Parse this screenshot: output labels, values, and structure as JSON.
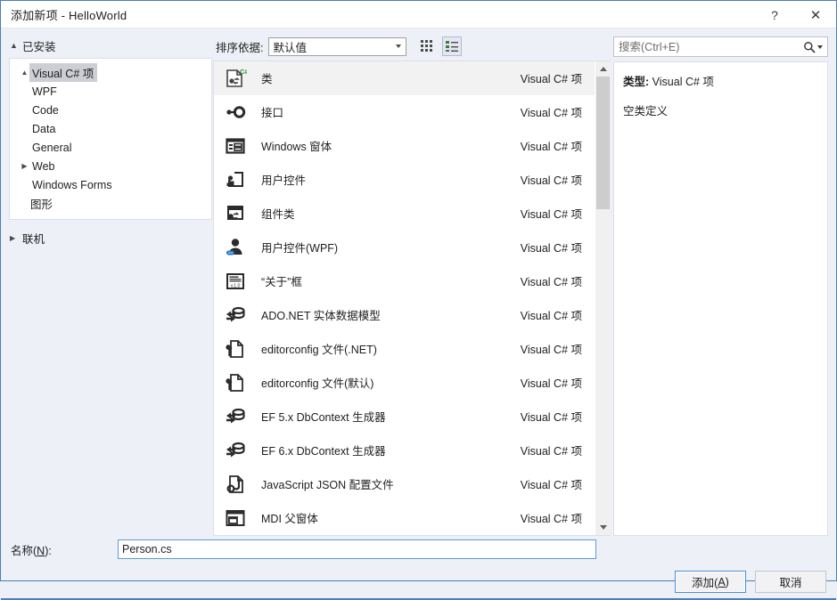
{
  "window": {
    "title": "添加新项 - HelloWorld",
    "help_label": "?",
    "close_label": "✕",
    "accent_color": "#4a7ebb"
  },
  "sidebar": {
    "installed_header": "已安装",
    "online_header": "联机",
    "tree": [
      {
        "label": "Visual C# 项",
        "depth": 0,
        "twisty": "▲",
        "selected": true
      },
      {
        "label": "WPF",
        "depth": 1,
        "twisty": "",
        "selected": false
      },
      {
        "label": "Code",
        "depth": 1,
        "twisty": "",
        "selected": false
      },
      {
        "label": "Data",
        "depth": 1,
        "twisty": "",
        "selected": false
      },
      {
        "label": "General",
        "depth": 1,
        "twisty": "",
        "selected": false
      },
      {
        "label": "Web",
        "depth": 1,
        "twisty": "▶",
        "selected": false
      },
      {
        "label": "Windows Forms",
        "depth": 1,
        "twisty": "",
        "selected": false
      },
      {
        "label": "图形",
        "depth": 0,
        "twisty": "",
        "selected": false
      }
    ]
  },
  "toolbar": {
    "sort_label": "排序依据:",
    "sort_value": "默认值",
    "view_tiles_name": "medium-icons-view",
    "view_details_name": "details-view",
    "active_view": "details"
  },
  "list": {
    "items": [
      {
        "name": "类",
        "kind": "Visual C# 项",
        "icon": "csharp-class-icon",
        "selected": true
      },
      {
        "name": "接口",
        "kind": "Visual C# 项",
        "icon": "interface-icon",
        "selected": false
      },
      {
        "name": "Windows 窗体",
        "kind": "Visual C# 项",
        "icon": "windows-form-icon",
        "selected": false
      },
      {
        "name": "用户控件",
        "kind": "Visual C# 项",
        "icon": "user-control-icon",
        "selected": false
      },
      {
        "name": "组件类",
        "kind": "Visual C# 项",
        "icon": "component-class-icon",
        "selected": false
      },
      {
        "name": "用户控件(WPF)",
        "kind": "Visual C# 项",
        "icon": "wpf-user-control-icon",
        "selected": false
      },
      {
        "name": "“关于”框",
        "kind": "Visual C# 项",
        "icon": "about-box-icon",
        "selected": false
      },
      {
        "name": "ADO.NET 实体数据模型",
        "kind": "Visual C# 项",
        "icon": "ado-entity-model-icon",
        "selected": false
      },
      {
        "name": "editorconfig 文件(.NET)",
        "kind": "Visual C# 项",
        "icon": "editorconfig-file-icon",
        "selected": false
      },
      {
        "name": "editorconfig 文件(默认)",
        "kind": "Visual C# 项",
        "icon": "editorconfig-file-icon",
        "selected": false
      },
      {
        "name": "EF 5.x DbContext 生成器",
        "kind": "Visual C# 项",
        "icon": "ado-entity-model-icon",
        "selected": false
      },
      {
        "name": "EF 6.x DbContext 生成器",
        "kind": "Visual C# 项",
        "icon": "ado-entity-model-icon",
        "selected": false
      },
      {
        "name": "JavaScript JSON 配置文件",
        "kind": "Visual C# 项",
        "icon": "json-file-icon",
        "selected": false
      },
      {
        "name": "MDI 父窗体",
        "kind": "Visual C# 项",
        "icon": "mdi-parent-form-icon",
        "selected": false
      }
    ],
    "scroll_thumb_top_pct": 0,
    "scroll_thumb_height_pct": 30
  },
  "search": {
    "placeholder": "搜索(Ctrl+E)",
    "value": ""
  },
  "details": {
    "type_label": "类型:",
    "type_value": "Visual C# 项",
    "description": "空类定义"
  },
  "footer": {
    "name_label_prefix": "名称(",
    "name_label_accel": "N",
    "name_label_suffix": "):",
    "name_value": "Person.cs",
    "add_prefix": "添加(",
    "add_accel": "A",
    "add_suffix": ")",
    "cancel_label": "取消"
  }
}
